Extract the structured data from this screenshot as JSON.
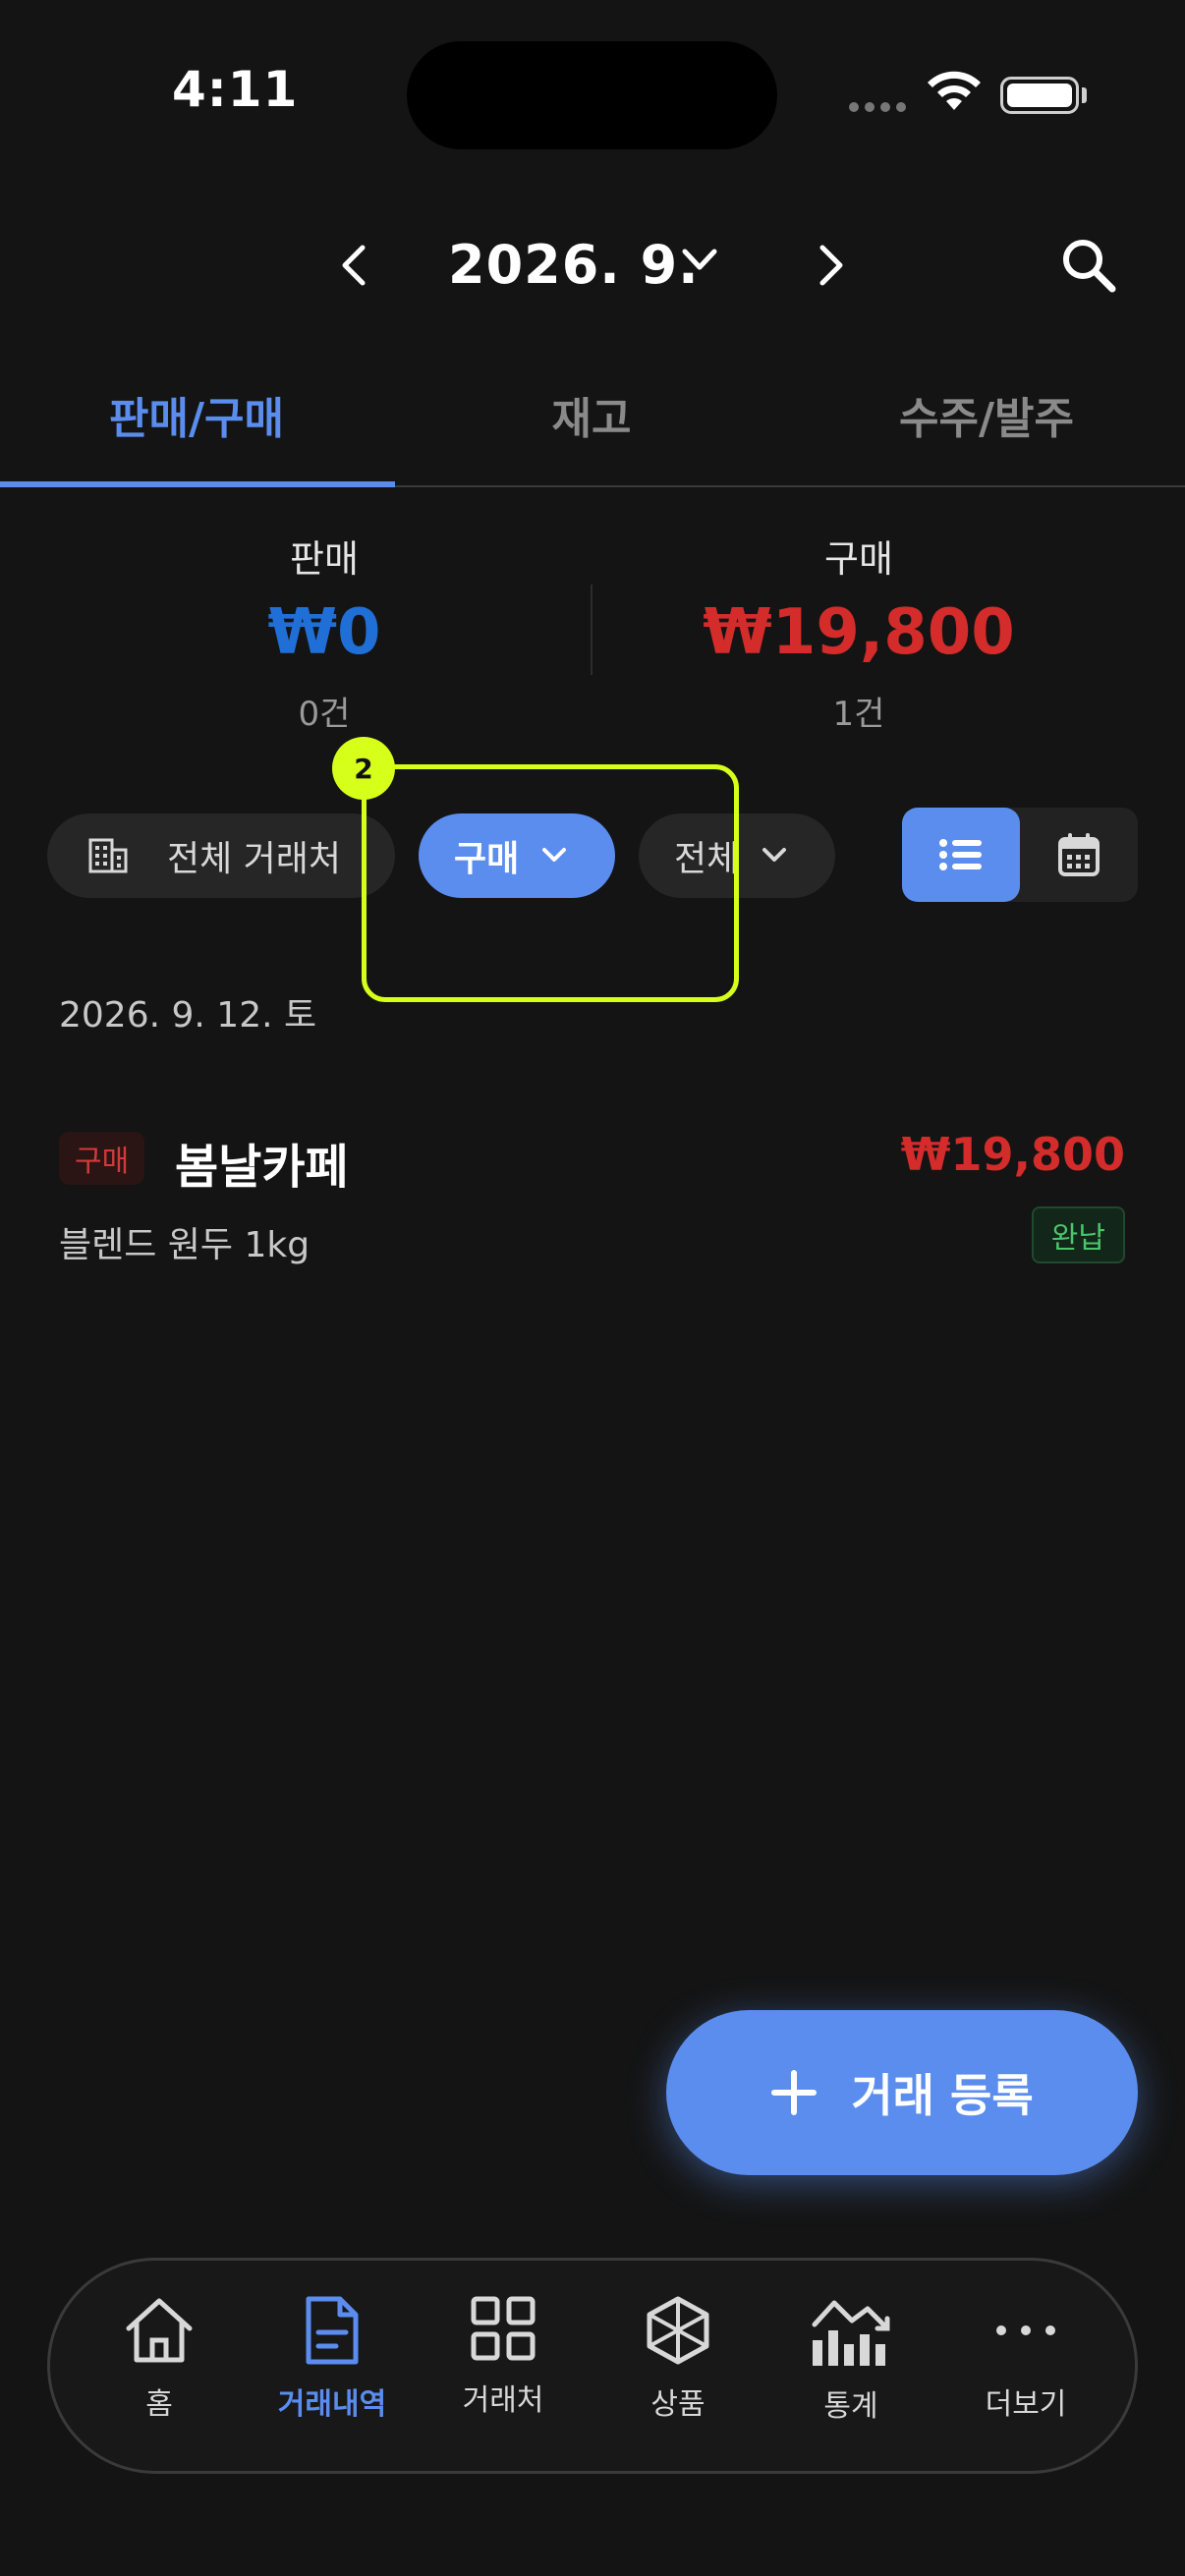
{
  "status_bar": {
    "time": "4:11"
  },
  "header": {
    "month": "2026. 9."
  },
  "tabs": [
    {
      "label": "판매/구매",
      "active": true
    },
    {
      "label": "재고",
      "active": false
    },
    {
      "label": "수주/발주",
      "active": false
    }
  ],
  "summary": {
    "sales": {
      "label": "판매",
      "amount": "₩0",
      "count": "0건",
      "color": "#1f6fd6"
    },
    "purchase": {
      "label": "구매",
      "amount": "₩19,800",
      "count": "1건",
      "color": "#d42b2b"
    }
  },
  "filters": {
    "partner": "전체 거래처",
    "type": "구매",
    "status": "전체"
  },
  "annotation": {
    "badge": "2"
  },
  "list": {
    "date": "2026. 9. 12. 토",
    "items": [
      {
        "type": "구매",
        "partner": "봄날카페",
        "amount": "₩19,800",
        "description": "블렌드 원두 1kg",
        "status": "완납"
      }
    ]
  },
  "fab": {
    "label": "거래 등록"
  },
  "bottom_nav": [
    {
      "label": "홈",
      "icon": "home-icon",
      "active": false
    },
    {
      "label": "거래내역",
      "icon": "document-icon",
      "active": true
    },
    {
      "label": "거래처",
      "icon": "grid-icon",
      "active": false
    },
    {
      "label": "상품",
      "icon": "cube-icon",
      "active": false
    },
    {
      "label": "통계",
      "icon": "chart-icon",
      "active": false
    },
    {
      "label": "더보기",
      "icon": "more-icon",
      "active": false
    }
  ],
  "colors": {
    "accent": "#5b8def",
    "background": "#141414",
    "annotation": "#d6ff1a"
  }
}
